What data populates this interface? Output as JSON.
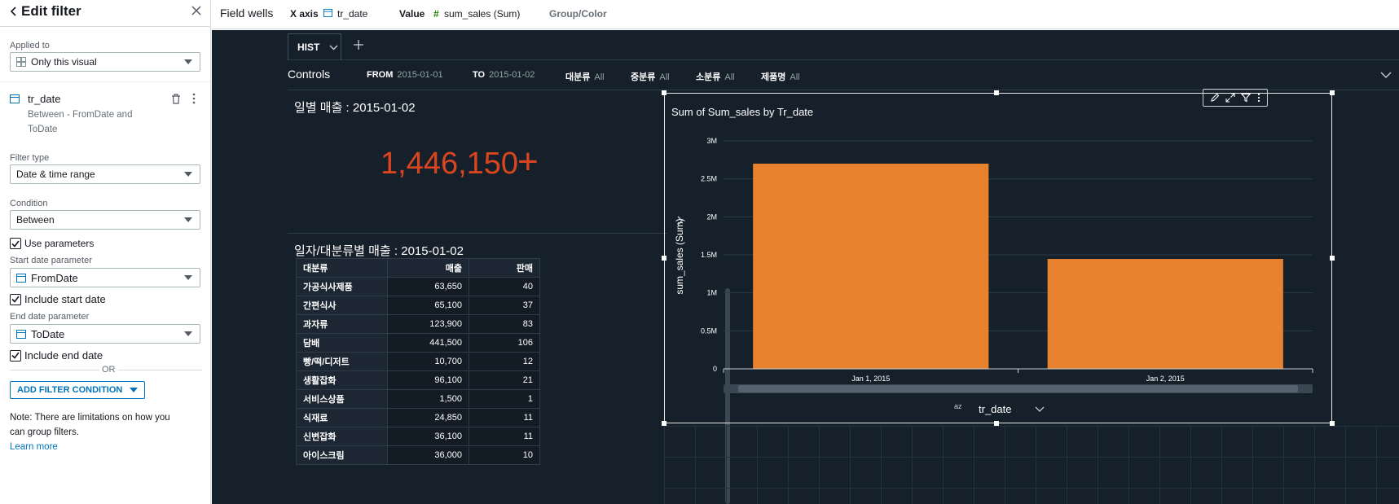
{
  "panel": {
    "title": "Edit filter",
    "applied_to_label": "Applied to",
    "applied_to_value": "Only this visual",
    "field_name": "tr_date",
    "field_desc_1": "Between - FromDate and",
    "field_desc_2": "ToDate",
    "filter_type_label": "Filter type",
    "filter_type_value": "Date & time range",
    "condition_label": "Condition",
    "condition_value": "Between",
    "use_parameters": "Use parameters",
    "start_param_label": "Start date parameter",
    "start_param_value": "FromDate",
    "include_start": "Include start date",
    "end_param_label": "End date parameter",
    "end_param_value": "ToDate",
    "include_end": "Include end date",
    "or_text": "OR",
    "add_filter": "ADD FILTER CONDITION",
    "note_1": "Note: There are limitations on how you",
    "note_2": "can group filters.",
    "learn_more": "Learn more"
  },
  "topbar": {
    "field_wells": "Field wells",
    "x_axis_label": "X axis",
    "x_axis_value": "tr_date",
    "value_label": "Value",
    "value_value": "sum_sales (Sum)",
    "group_color": "Group/Color"
  },
  "sheet": {
    "tab_label": "HIST",
    "controls_label": "Controls",
    "controls": [
      {
        "name": "FROM",
        "value": "2015-01-01"
      },
      {
        "name": "TO",
        "value": "2015-01-02"
      },
      {
        "name": "대분류",
        "value": "All"
      },
      {
        "name": "중분류",
        "value": "All"
      },
      {
        "name": "소분류",
        "value": "All"
      },
      {
        "name": "제품명",
        "value": "All"
      }
    ]
  },
  "kpi": {
    "title": "일별 매출 : 2015-01-02",
    "value": "1,446,150",
    "trend_symbol": "+",
    "color": "#d9451e"
  },
  "table": {
    "title": "일자/대분류별 매출 : 2015-01-02",
    "headers": [
      "대분류",
      "매출",
      "판매"
    ],
    "rows": [
      [
        "가공식사제품",
        "63,650",
        "40"
      ],
      [
        "간편식사",
        "65,100",
        "37"
      ],
      [
        "과자류",
        "123,900",
        "83"
      ],
      [
        "담배",
        "441,500",
        "106"
      ],
      [
        "빵/떡/디저트",
        "10,700",
        "12"
      ],
      [
        "생활잡화",
        "96,100",
        "21"
      ],
      [
        "서비스상품",
        "1,500",
        "1"
      ],
      [
        "식재료",
        "24,850",
        "11"
      ],
      [
        "신변잡화",
        "36,100",
        "11"
      ],
      [
        "아이스크림",
        "36,000",
        "10"
      ]
    ]
  },
  "chart_data": {
    "type": "bar",
    "title": "Sum of Sum_sales by Tr_date",
    "xlabel": "tr_date",
    "ylabel": "sum_sales (Sum)",
    "categories": [
      "Jan 1, 2015",
      "Jan 2, 2015"
    ],
    "values": [
      2700000,
      1446150
    ],
    "ylim": [
      0,
      3000000
    ],
    "yticks": [
      "0",
      "0.5M",
      "1M",
      "1.5M",
      "2M",
      "2.5M",
      "3M"
    ],
    "color": "#e8822e",
    "grid": true
  }
}
